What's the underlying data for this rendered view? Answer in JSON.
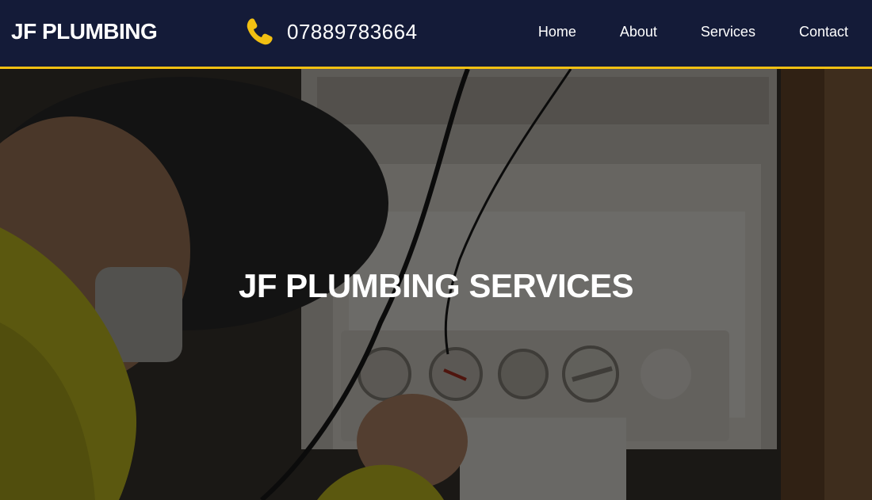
{
  "brand": {
    "name": "JF PLUMBING"
  },
  "contact": {
    "phone": "07889783664",
    "icon": "phone-icon"
  },
  "nav": {
    "items": [
      {
        "label": "Home"
      },
      {
        "label": "About"
      },
      {
        "label": "Services"
      },
      {
        "label": "Contact"
      }
    ]
  },
  "hero": {
    "title": "JF PLUMBING SERVICES",
    "image": "boiler-repair-photo"
  },
  "colors": {
    "navbar_bg": "#141b38",
    "accent": "#f2c012",
    "text": "#ffffff"
  }
}
